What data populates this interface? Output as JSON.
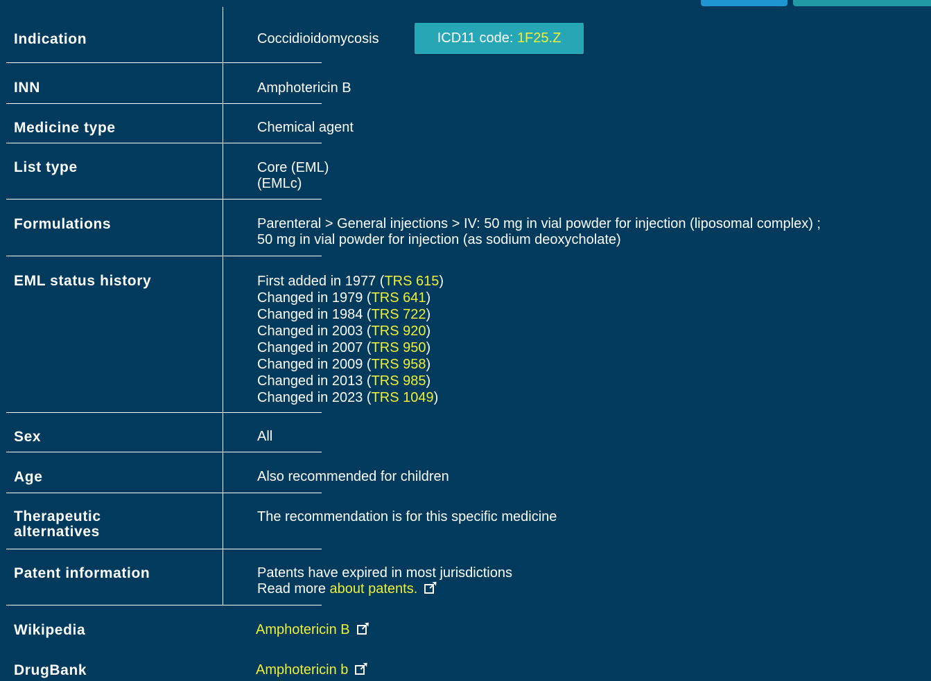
{
  "rows": {
    "indication": {
      "label": "Indication",
      "value": "Coccidioidomycosis",
      "icd_prefix": "ICD11 code: ",
      "icd_code": "1F25.Z"
    },
    "inn": {
      "label": "INN",
      "value": "Amphotericin B"
    },
    "medicine_type": {
      "label": "Medicine type",
      "value": "Chemical agent"
    },
    "list_type": {
      "label": "List type",
      "line1": "Core (EML)",
      "line2": "(EMLc)"
    },
    "formulations": {
      "label": "Formulations",
      "line1": "Parenteral > General injections > IV: 50 mg in vial powder for injection (liposomal complex) ;",
      "line2": "50 mg in vial powder for injection (as sodium deoxycholate)"
    },
    "eml_status_history": {
      "label": "EML status history",
      "entries": [
        {
          "text": "First added in 1977 (",
          "trs": "TRS 615",
          "close": ")"
        },
        {
          "text": "Changed in 1979 (",
          "trs": "TRS 641",
          "close": ")"
        },
        {
          "text": "Changed in 1984 (",
          "trs": "TRS 722",
          "close": ")"
        },
        {
          "text": "Changed in 2003 (",
          "trs": "TRS 920",
          "close": ")"
        },
        {
          "text": "Changed in 2007 (",
          "trs": "TRS 950",
          "close": ")"
        },
        {
          "text": "Changed in 2009 (",
          "trs": "TRS 958",
          "close": ")"
        },
        {
          "text": "Changed in 2013 (",
          "trs": "TRS 985",
          "close": ")"
        },
        {
          "text": "Changed in 2023 (",
          "trs": "TRS 1049",
          "close": ")"
        }
      ]
    },
    "sex": {
      "label": "Sex",
      "value": "All"
    },
    "age": {
      "label": "Age",
      "value": "Also recommended for children"
    },
    "therapeutic_alternatives": {
      "label_line1": "Therapeutic",
      "label_line2": "alternatives",
      "value": "The recommendation is for this specific medicine"
    },
    "patent_information": {
      "label": "Patent information",
      "line1": "Patents have expired in most jurisdictions",
      "read_more": "Read more ",
      "link": "about patents."
    },
    "wikipedia": {
      "label": "Wikipedia",
      "link": "Amphotericin B"
    },
    "drugbank": {
      "label": "DrugBank",
      "link": "Amphotericin b"
    }
  },
  "icons": {
    "external": "external-link-icon"
  },
  "colors": {
    "background": "#003a5d",
    "link": "#f2ef3a",
    "badge": "#27a7b5",
    "top_button_1": "#1e96d2",
    "top_button_2": "#219aa3"
  }
}
